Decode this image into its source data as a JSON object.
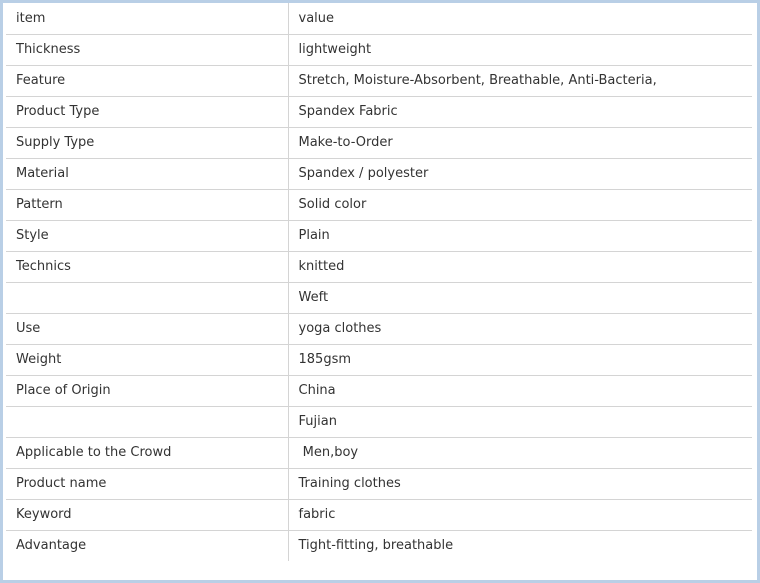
{
  "table": {
    "header": {
      "item": "item",
      "value": "value"
    },
    "rows": [
      {
        "item": "Thickness",
        "value": "lightweight"
      },
      {
        "item": "Feature",
        "value": "Stretch, Moisture-Absorbent, Breathable, Anti-Bacteria,"
      },
      {
        "item": "Product Type",
        "value": "Spandex Fabric"
      },
      {
        "item": "Supply Type",
        "value": "Make-to-Order"
      },
      {
        "item": "Material",
        "value": "Spandex / polyester"
      },
      {
        "item": "Pattern",
        "value": "Solid color"
      },
      {
        "item": "Style",
        "value": "Plain"
      },
      {
        "item": "Technics",
        "value": "knitted"
      },
      {
        "item": "",
        "value": "Weft"
      },
      {
        "item": "Use",
        "value": "yoga clothes"
      },
      {
        "item": "Weight",
        "value": "185gsm"
      },
      {
        "item": "Place of Origin",
        "value": "China"
      },
      {
        "item": "",
        "value": "Fujian"
      },
      {
        "item": "Applicable to the Crowd",
        "value": " Men,boy"
      },
      {
        "item": "Product name",
        "value": "Training clothes"
      },
      {
        "item": "Keyword",
        "value": "fabric"
      },
      {
        "item": "Advantage",
        "value": "Tight-fitting, breathable"
      }
    ]
  },
  "colors": {
    "frame_border": "#b9cfe6",
    "cell_border": "#d4d4d4",
    "text": "#333333"
  }
}
